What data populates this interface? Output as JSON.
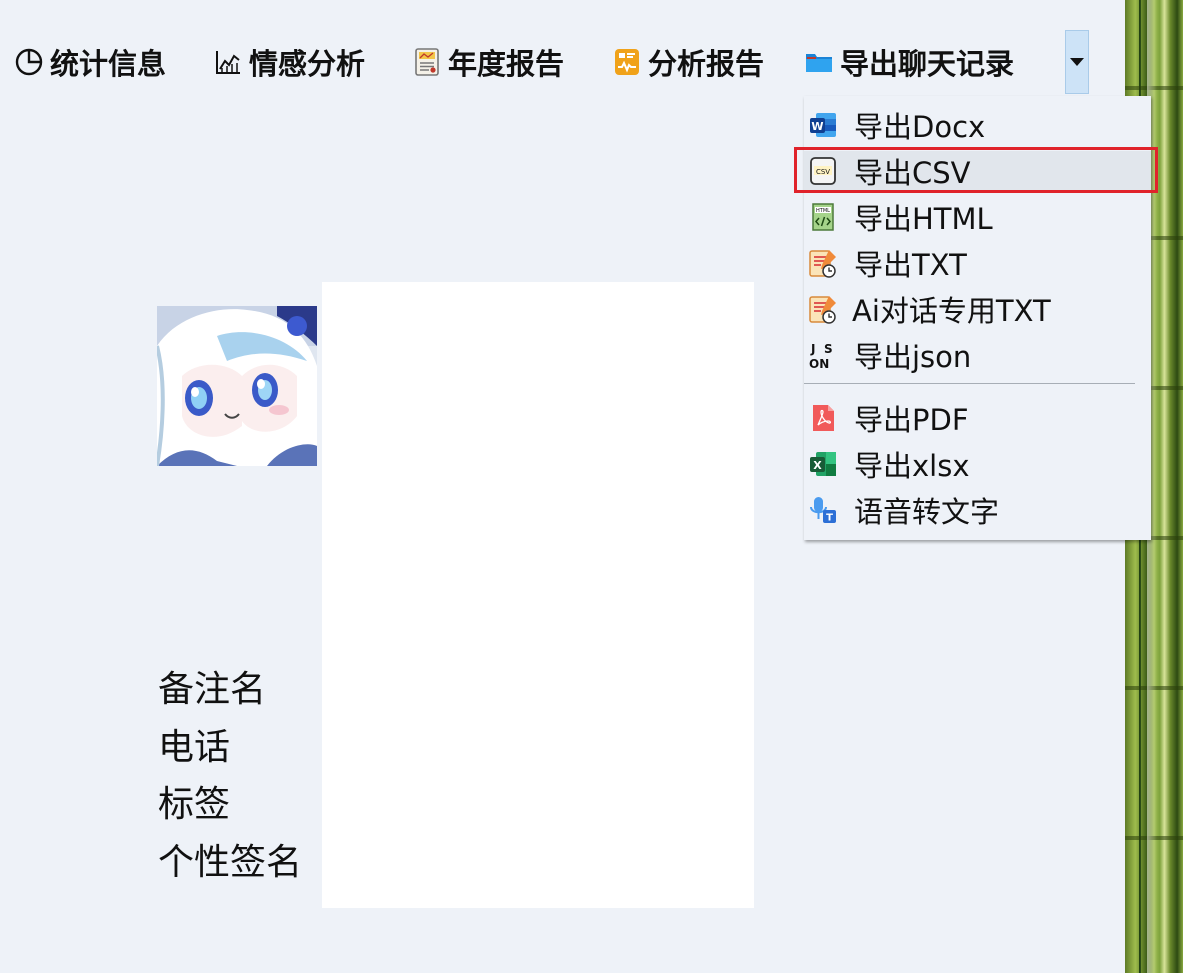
{
  "toolbar": {
    "stats": "统计信息",
    "sentiment": "情感分析",
    "annual": "年度报告",
    "analysis": "分析报告",
    "export": "导出聊天记录"
  },
  "export_menu": {
    "items": [
      {
        "label": "导出Docx",
        "icon": "word-icon"
      },
      {
        "label": "导出CSV",
        "icon": "csv-icon",
        "highlighted": true
      },
      {
        "label": "导出HTML",
        "icon": "html-icon"
      },
      {
        "label": "导出TXT",
        "icon": "txt-icon"
      },
      {
        "label": "Ai对话专用TXT",
        "icon": "txt-icon"
      },
      {
        "label": "导出json",
        "icon": "json-icon"
      },
      {
        "label": "导出PDF",
        "icon": "pdf-icon"
      },
      {
        "label": "导出xlsx",
        "icon": "excel-icon"
      },
      {
        "label": "语音转文字",
        "icon": "speech-to-text-icon"
      }
    ]
  },
  "profile": {
    "remark": "备注名",
    "phone": "电话",
    "tags": "标签",
    "signature": "个性签名"
  },
  "colors": {
    "background": "#eef2f8",
    "highlight_border": "#e0232b",
    "toggle_bg": "#cde3f7"
  }
}
